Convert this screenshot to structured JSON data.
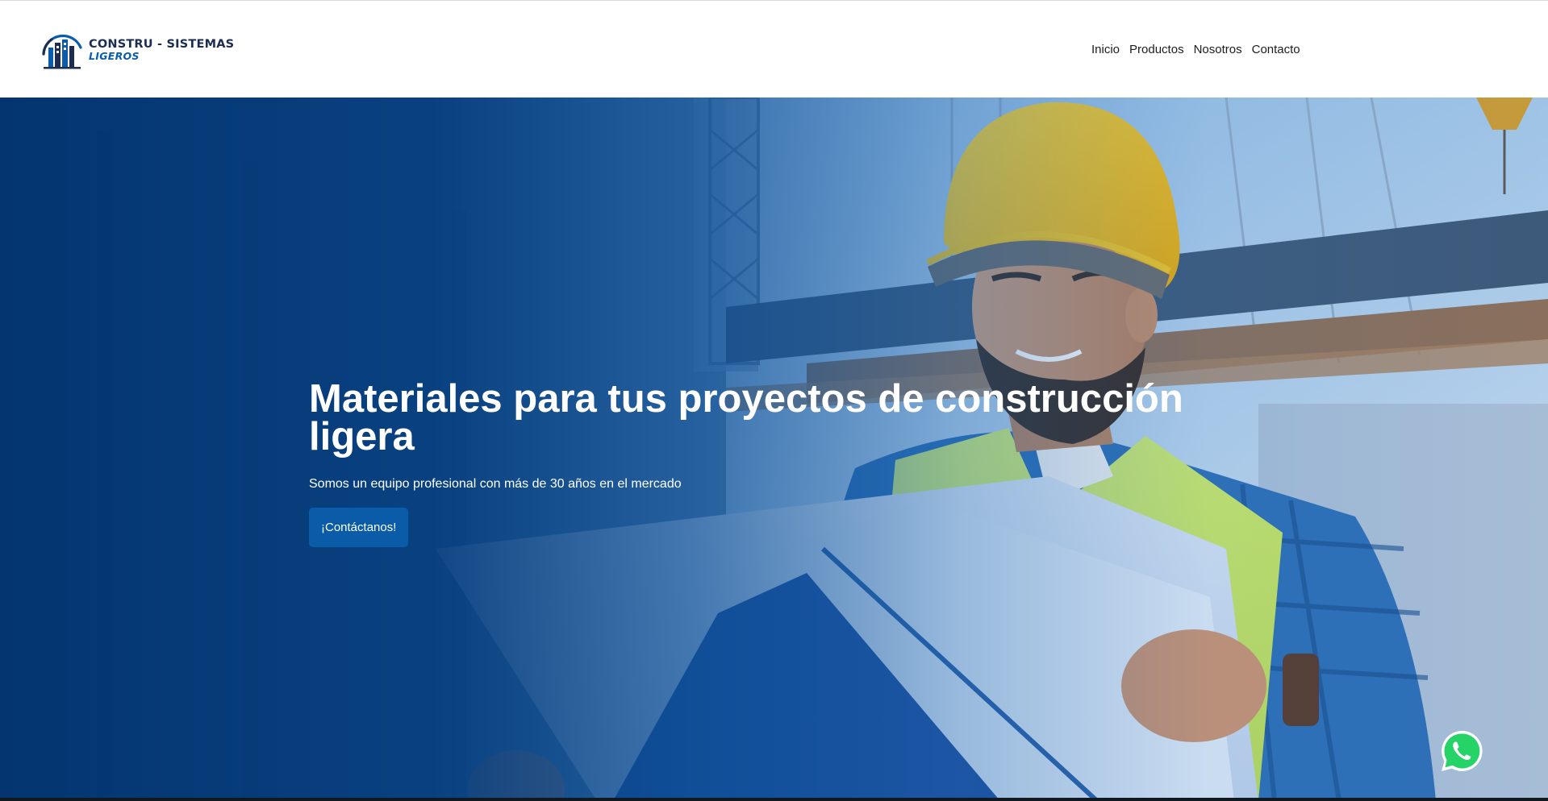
{
  "header": {
    "logo": {
      "line1": "CONSTRU - SISTEMAS",
      "line2": "LIGEROS",
      "icon": "buildings-logo-icon"
    },
    "nav": [
      {
        "label": "Inicio"
      },
      {
        "label": "Productos"
      },
      {
        "label": "Nosotros"
      },
      {
        "label": "Contacto"
      }
    ]
  },
  "hero": {
    "title": "Materiales para tus proyectos de construcción ligera",
    "subtitle": "Somos un equipo profesional con más de 30 años en el mercado",
    "cta_label": "¡Contáctanos!",
    "background": "construction-worker-photo"
  },
  "floating": {
    "whatsapp_icon": "whatsapp-icon"
  },
  "colors": {
    "brand_dark": "#1c2d50",
    "brand_blue": "#0a5cad",
    "cta_blue": "#0b5ca8",
    "whatsapp_green": "#25d366",
    "hero_overlay": "#00326e"
  }
}
